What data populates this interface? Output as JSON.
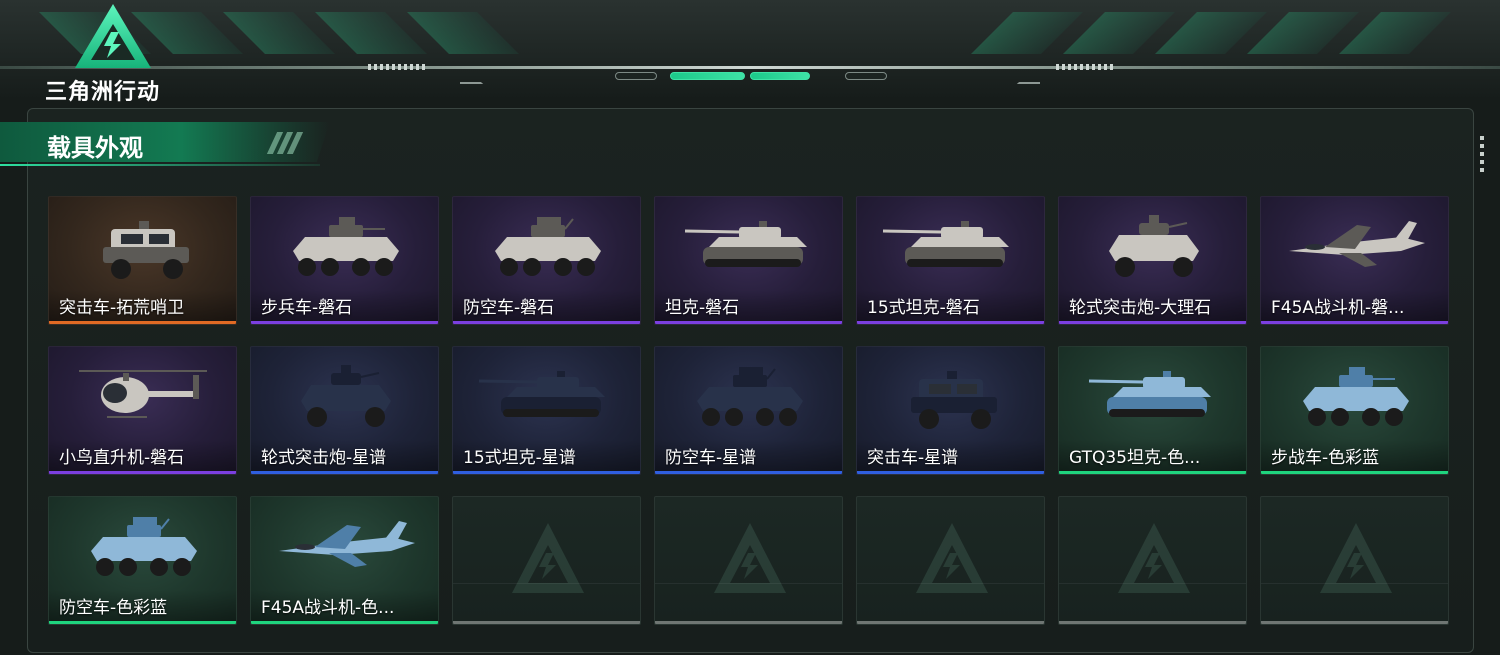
{
  "game": {
    "logo_text": "三角洲行动"
  },
  "section": {
    "title": "载具外观"
  },
  "colors": {
    "accent": "#2ee0a0",
    "rarity_purple": "#7b3fe0",
    "rarity_blue": "#2f5fe0",
    "rarity_orange": "#e06a24",
    "rarity_green": "#1fd47e",
    "rarity_empty": "#6f7673"
  },
  "skins": [
    {
      "name": "突击车-拓荒哨卫",
      "rarity": "orange",
      "icon": "armored-suv-icon"
    },
    {
      "name": "步兵车-磐石",
      "rarity": "purple",
      "icon": "wheeled-ifv-icon"
    },
    {
      "name": "防空车-磐石",
      "rarity": "purple",
      "icon": "wheeled-aa-vehicle-icon"
    },
    {
      "name": "坦克-磐石",
      "rarity": "purple",
      "icon": "tank-icon"
    },
    {
      "name": "15式坦克-磐石",
      "rarity": "purple",
      "icon": "light-tank-icon"
    },
    {
      "name": "轮式突击炮-大理石",
      "rarity": "purple",
      "icon": "wheeled-assault-gun-icon"
    },
    {
      "name": "F45A战斗机-磐...",
      "rarity": "purple",
      "icon": "fighter-jet-icon"
    },
    {
      "name": "小鸟直升机-磐石",
      "rarity": "purple",
      "icon": "helicopter-icon"
    },
    {
      "name": "轮式突击炮-星谱",
      "rarity": "blue",
      "icon": "wheeled-assault-gun-icon"
    },
    {
      "name": "15式坦克-星谱",
      "rarity": "blue",
      "icon": "light-tank-icon"
    },
    {
      "name": "防空车-星谱",
      "rarity": "blue",
      "icon": "wheeled-aa-vehicle-icon"
    },
    {
      "name": "突击车-星谱",
      "rarity": "blue",
      "icon": "armored-suv-icon"
    },
    {
      "name": "GTQ35坦克-色...",
      "rarity": "green",
      "icon": "tank-icon"
    },
    {
      "name": "步战车-色彩蓝",
      "rarity": "green",
      "icon": "wheeled-ifv-icon"
    },
    {
      "name": "防空车-色彩蓝",
      "rarity": "green",
      "icon": "wheeled-aa-vehicle-icon"
    },
    {
      "name": "F45A战斗机-色...",
      "rarity": "green",
      "icon": "fighter-jet-icon"
    },
    {
      "name": "",
      "rarity": "empty",
      "icon": "empty-slot-icon"
    },
    {
      "name": "",
      "rarity": "empty",
      "icon": "empty-slot-icon"
    },
    {
      "name": "",
      "rarity": "empty",
      "icon": "empty-slot-icon"
    },
    {
      "name": "",
      "rarity": "empty",
      "icon": "empty-slot-icon"
    },
    {
      "name": "",
      "rarity": "empty",
      "icon": "empty-slot-icon"
    }
  ]
}
